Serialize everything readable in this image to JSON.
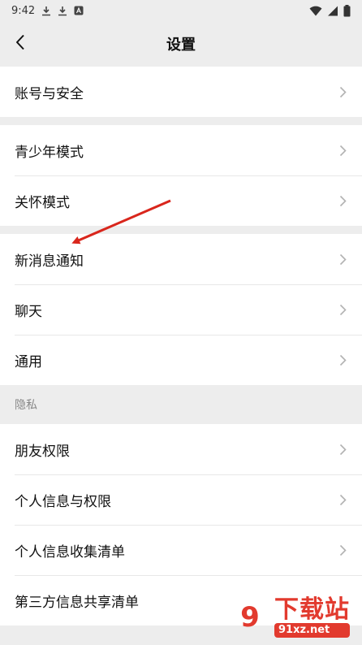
{
  "status_bar": {
    "time": "9:42"
  },
  "nav": {
    "title": "设置"
  },
  "groups": [
    {
      "items": [
        "账号与安全"
      ]
    },
    {
      "items": [
        "青少年模式",
        "关怀模式"
      ]
    },
    {
      "items": [
        "新消息通知",
        "聊天",
        "通用"
      ]
    }
  ],
  "privacy": {
    "header": "隐私",
    "items": [
      "朋友权限",
      "个人信息与权限",
      "个人信息收集清单",
      "第三方信息共享清单"
    ]
  },
  "watermark": {
    "logo": "9",
    "title": "下载站",
    "url": "91xz.net"
  },
  "colors": {
    "arrow": "#d9261c",
    "brand_red": "#e23a2e"
  }
}
